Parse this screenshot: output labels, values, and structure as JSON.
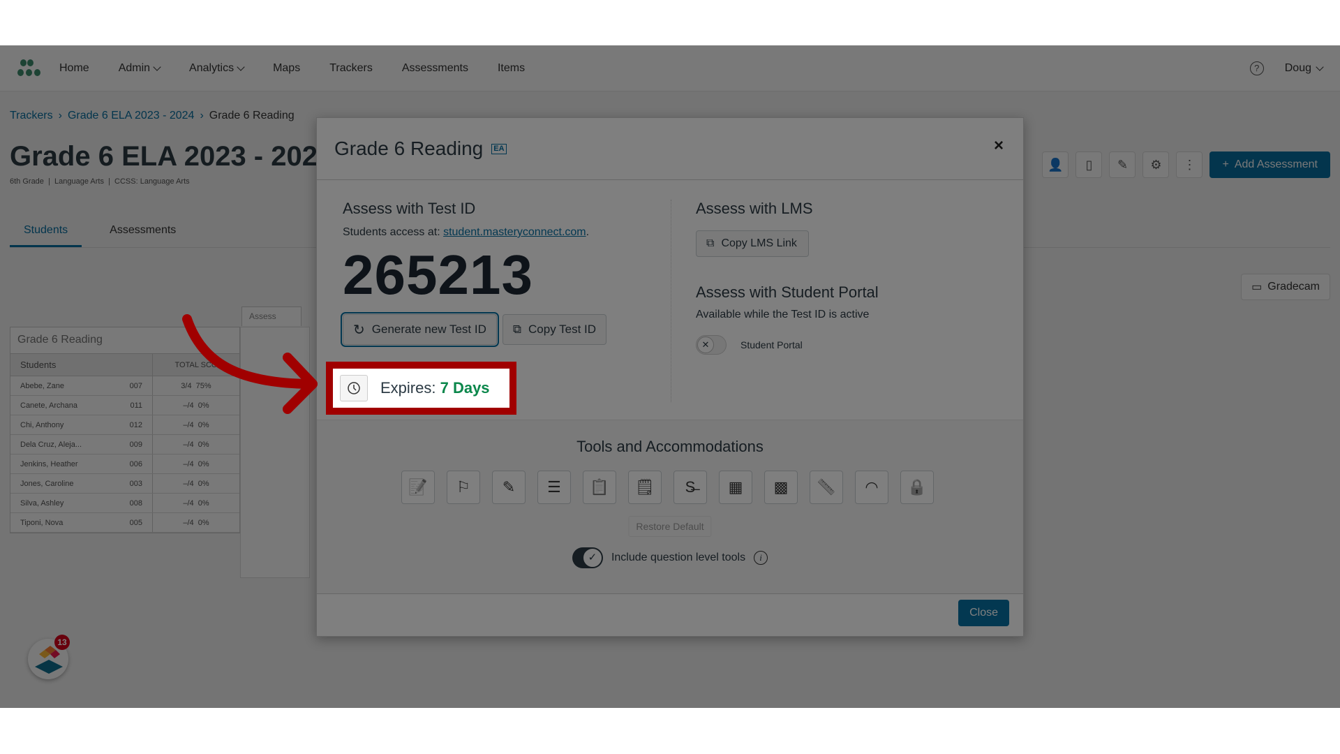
{
  "nav": {
    "items": [
      "Home",
      "Admin",
      "Analytics",
      "Maps",
      "Trackers",
      "Assessments",
      "Items"
    ],
    "dropdowns": [
      false,
      true,
      true,
      false,
      false,
      false,
      false
    ],
    "user": "Doug"
  },
  "breadcrumb": [
    "Trackers",
    "Grade 6 ELA 2023 - 2024",
    "Grade 6 Reading"
  ],
  "page": {
    "title": "Grade 6 ELA 2023 - 2024",
    "subtitle": "6th Grade  |  Language Arts  |  CCSS: Language Arts",
    "tabs": [
      "Students",
      "Assessments"
    ],
    "add_button": "Add Assessment",
    "gradecam": "Gradecam"
  },
  "table": {
    "assess_tab": "Assess",
    "title": "Grade 6 Reading",
    "header_students": "Students",
    "header_score": "TOTAL SCO",
    "rows": [
      [
        "Abebe, Zane",
        "007",
        "3/4  75%"
      ],
      [
        "Canete, Archana",
        "011",
        "–/4  0%"
      ],
      [
        "Chi, Anthony",
        "012",
        "–/4  0%"
      ],
      [
        "Dela Cruz, Aleja...",
        "009",
        "–/4  0%"
      ],
      [
        "Jenkins, Heather",
        "006",
        "–/4  0%"
      ],
      [
        "Jones, Caroline",
        "003",
        "–/4  0%"
      ],
      [
        "Silva, Ashley",
        "008",
        "–/4  0%"
      ],
      [
        "Tiponi, Nova",
        "005",
        "–/4  0%"
      ]
    ]
  },
  "modal": {
    "title": "Grade 6 Reading",
    "badge": "EA",
    "test_id": {
      "heading": "Assess with Test ID",
      "access_prefix": "Students access at: ",
      "access_link": "student.masteryconnect.com",
      "access_suffix": ".",
      "code": "265213",
      "generate": "Generate new Test ID",
      "copy": "Copy Test ID",
      "expires_label": "Expires: ",
      "expires_value": "7 Days"
    },
    "lms": {
      "heading": "Assess with LMS",
      "copy": "Copy LMS Link"
    },
    "portal": {
      "heading": "Assess with Student Portal",
      "note": "Available while the Test ID is active",
      "toggle_label": "Student Portal",
      "enabled": false
    },
    "tools": {
      "heading": "Tools and Accommodations",
      "icons": [
        "notepad-icon",
        "flag-icon",
        "highlighter-icon",
        "line-reader-icon",
        "clipboard-edit-icon",
        "sticky-note-icon",
        "strikethrough-icon",
        "calculator-icon",
        "scientific-calculator-icon",
        "ruler-icon",
        "protractor-icon",
        "lock-icon"
      ],
      "restore": "Restore Default",
      "question_tools_label": "Include question level tools",
      "question_tools_enabled": true
    },
    "close": "Close"
  },
  "fab": {
    "badge": "13"
  },
  "colors": {
    "primary": "#0770a3",
    "success": "#0b874b",
    "highlight": "#a00000",
    "badge": "#d0021b"
  }
}
